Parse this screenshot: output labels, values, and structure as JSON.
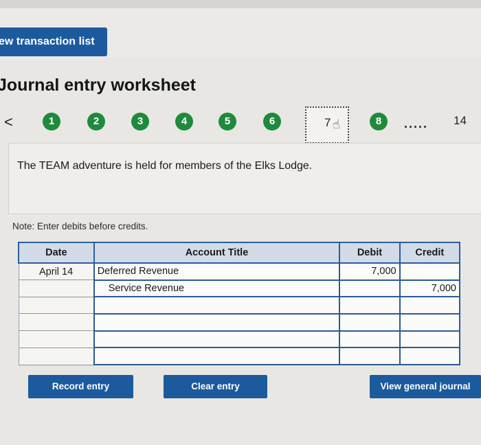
{
  "header": {
    "view_transactions_label": "ew transaction list"
  },
  "worksheet": {
    "title": "Journal entry worksheet",
    "pager": {
      "prev_icon": "chevron-left-icon",
      "steps": [
        "1",
        "2",
        "3",
        "4",
        "5",
        "6",
        "7",
        "8"
      ],
      "current_step": "7",
      "ellipsis": ".....",
      "last_step": "14",
      "step_color": "#1f8a3c"
    },
    "question": "The TEAM adventure is held for members of the Elks Lodge.",
    "note": "Note: Enter debits before credits.",
    "table": {
      "columns": [
        "Date",
        "Account Title",
        "Debit",
        "Credit"
      ],
      "rows": [
        {
          "date": "April 14",
          "account": "Deferred Revenue",
          "debit": "7,000",
          "credit": ""
        },
        {
          "date": "",
          "account": "Service Revenue",
          "debit": "",
          "credit": "7,000"
        },
        {
          "date": "",
          "account": "",
          "debit": "",
          "credit": ""
        },
        {
          "date": "",
          "account": "",
          "debit": "",
          "credit": ""
        },
        {
          "date": "",
          "account": "",
          "debit": "",
          "credit": ""
        },
        {
          "date": "",
          "account": "",
          "debit": "",
          "credit": ""
        }
      ]
    },
    "buttons": {
      "record": "Record entry",
      "clear": "Clear entry",
      "view_journal": "View general journal"
    },
    "accent_color": "#1c5a9e"
  }
}
